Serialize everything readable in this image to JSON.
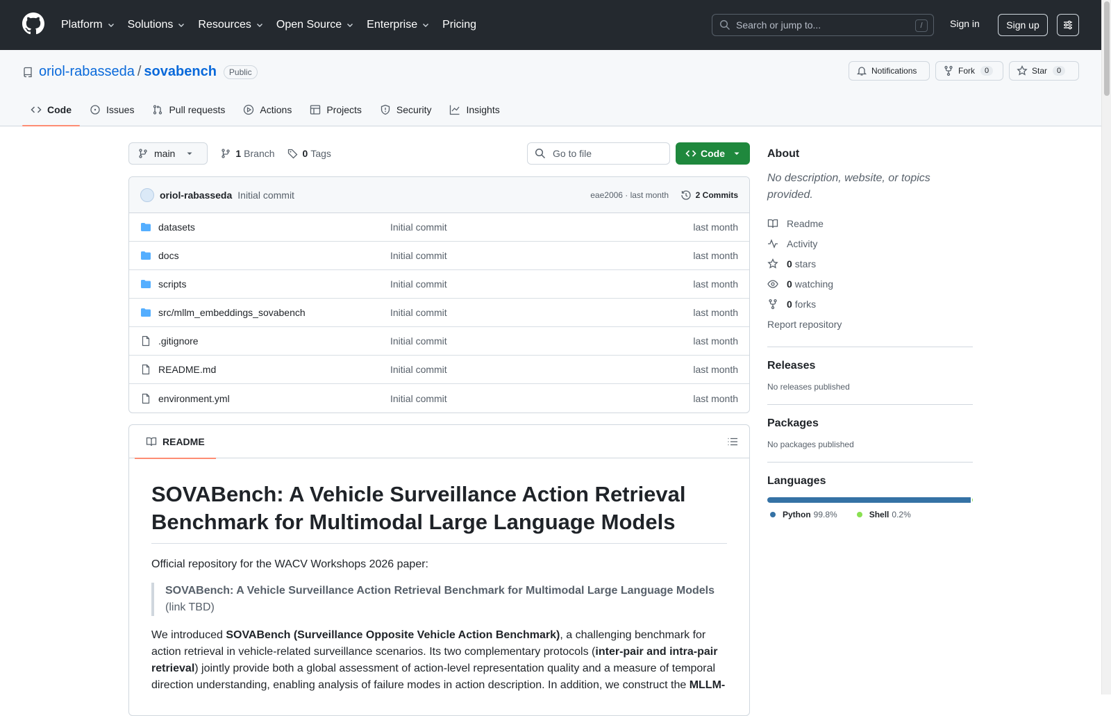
{
  "header": {
    "nav": [
      "Platform",
      "Solutions",
      "Resources",
      "Open Source",
      "Enterprise",
      "Pricing"
    ],
    "nav_has_chevron": [
      true,
      true,
      true,
      true,
      true,
      false
    ],
    "search_placeholder": "Search or jump to...",
    "search_shortcut": "/",
    "sign_in": "Sign in",
    "sign_up": "Sign up"
  },
  "repo": {
    "owner": "oriol-rabasseda",
    "separator": "/",
    "name": "sovabench",
    "visibility": "Public",
    "notifications_label": "Notifications",
    "fork_label": "Fork",
    "fork_count": "0",
    "star_label": "Star",
    "star_count": "0",
    "tabs": [
      "Code",
      "Issues",
      "Pull requests",
      "Actions",
      "Projects",
      "Security",
      "Insights"
    ]
  },
  "toolbar": {
    "branch": "main",
    "branch_count": "1",
    "branch_label": "Branch",
    "tag_count": "0",
    "tag_label": "Tags",
    "go_to_file_placeholder": "Go to file",
    "code_button": "Code"
  },
  "latest_commit": {
    "author": "oriol-rabasseda",
    "message": "Initial commit",
    "meta": "eae2006 · last month",
    "commits": "2 Commits"
  },
  "files": [
    {
      "name": "datasets",
      "type": "dir",
      "commit": "Initial commit",
      "age": "last month"
    },
    {
      "name": "docs",
      "type": "dir",
      "commit": "Initial commit",
      "age": "last month"
    },
    {
      "name": "scripts",
      "type": "dir",
      "commit": "Initial commit",
      "age": "last month"
    },
    {
      "name": "src/mllm_embeddings_sovabench",
      "type": "dir",
      "commit": "Initial commit",
      "age": "last month"
    },
    {
      "name": ".gitignore",
      "type": "file",
      "commit": "Initial commit",
      "age": "last month"
    },
    {
      "name": "README.md",
      "type": "file",
      "commit": "Initial commit",
      "age": "last month"
    },
    {
      "name": "environment.yml",
      "type": "file",
      "commit": "Initial commit",
      "age": "last month"
    }
  ],
  "readme": {
    "tab_label": "README",
    "title": "SOVABench: A Vehicle Surveillance Action Retrieval Benchmark for Multimodal Large Language Models",
    "intro": "Official repository for the WACV Workshops 2026 paper:",
    "quote_title": "SOVABench: A Vehicle Surveillance Action Retrieval Benchmark for Multimodal Large Language Models",
    "quote_link": "(link TBD)",
    "p1_a": "We introduced ",
    "p1_b": "SOVABench (Surveillance Opposite Vehicle Action Benchmark)",
    "p1_c": ", a challenging benchmark for action retrieval in vehicle-related surveillance scenarios. Its two complementary protocols (",
    "p1_d": "inter-pair and intra-pair retrieval",
    "p1_e": ") jointly provide both a global assessment of action-level representation quality and a measure of temporal direction understanding, enabling analysis of failure modes in action description. In addition, we construct the ",
    "p1_f": "MLLM-"
  },
  "about": {
    "heading": "About",
    "description": "No description, website, or topics provided.",
    "readme": "Readme",
    "activity": "Activity",
    "stars_count": "0",
    "stars_label": "stars",
    "watching_count": "0",
    "watching_label": "watching",
    "forks_count": "0",
    "forks_label": "forks",
    "report": "Report repository"
  },
  "releases": {
    "heading": "Releases",
    "text": "No releases published"
  },
  "packages": {
    "heading": "Packages",
    "text": "No packages published"
  },
  "languages": {
    "heading": "Languages",
    "items": [
      {
        "name": "Python",
        "percent": "99.8%",
        "value": 99.8,
        "color": "#3572A5"
      },
      {
        "name": "Shell",
        "percent": "0.2%",
        "value": 0.2,
        "color": "#89e051"
      }
    ]
  },
  "colors": {
    "accent_blue": "#0969da",
    "header_bg": "#24292f",
    "code_green": "#1f883d",
    "tab_underline": "#fd8c73"
  }
}
